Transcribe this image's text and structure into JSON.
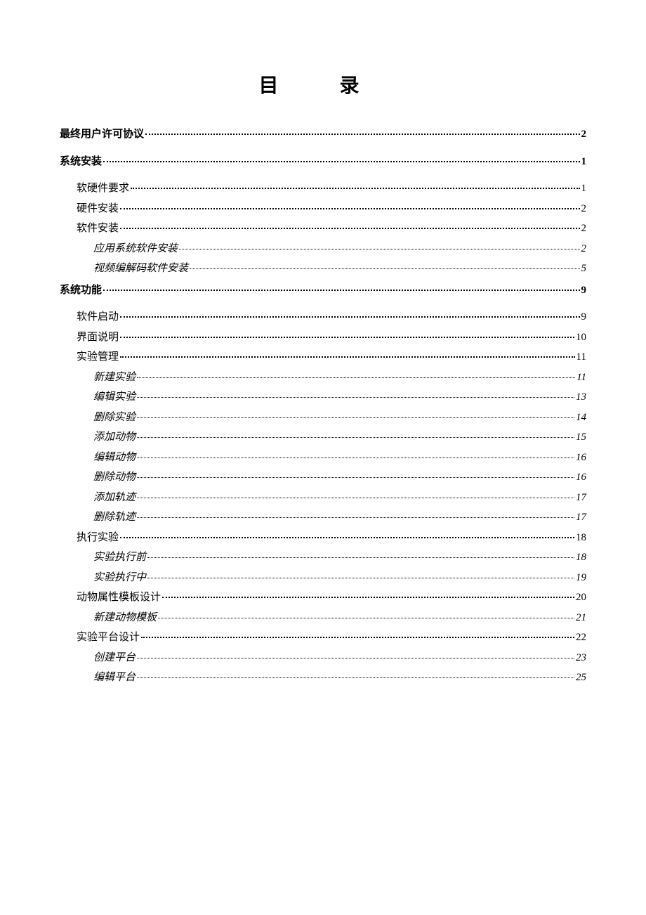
{
  "title": "目 录",
  "toc": [
    {
      "level": 1,
      "label": "最终用户许可协议",
      "page": "2"
    },
    {
      "level": 1,
      "label": "系统安装",
      "page": "1"
    },
    {
      "level": 2,
      "label": "软硬件要求",
      "page": "1"
    },
    {
      "level": 2,
      "label": "硬件安装",
      "page": "2"
    },
    {
      "level": 2,
      "label": "软件安装",
      "page": "2"
    },
    {
      "level": 3,
      "label": "应用系统软件安装",
      "page": "2"
    },
    {
      "level": 3,
      "label": "视频编解码软件安装",
      "page": "5"
    },
    {
      "level": 1,
      "label": "系统功能",
      "page": "9"
    },
    {
      "level": 2,
      "label": "软件启动",
      "page": "9"
    },
    {
      "level": 2,
      "label": "界面说明",
      "page": "10"
    },
    {
      "level": 2,
      "label": "实验管理",
      "page": "11"
    },
    {
      "level": 3,
      "label": "新建实验",
      "page": "11"
    },
    {
      "level": 3,
      "label": "编辑实验",
      "page": "13"
    },
    {
      "level": 3,
      "label": "删除实验",
      "page": "14"
    },
    {
      "level": 3,
      "label": "添加动物",
      "page": "15"
    },
    {
      "level": 3,
      "label": "编辑动物",
      "page": "16"
    },
    {
      "level": 3,
      "label": "删除动物",
      "page": "16"
    },
    {
      "level": 3,
      "label": "添加轨迹",
      "page": "17"
    },
    {
      "level": 3,
      "label": "删除轨迹",
      "page": "17"
    },
    {
      "level": 2,
      "label": "执行实验",
      "page": "18"
    },
    {
      "level": 3,
      "label": "实验执行前",
      "page": "18"
    },
    {
      "level": 3,
      "label": "实验执行中",
      "page": "19"
    },
    {
      "level": 2,
      "label": "动物属性模板设计",
      "page": "20"
    },
    {
      "level": 3,
      "label": "新建动物模板",
      "page": "21"
    },
    {
      "level": 2,
      "label": "实验平台设计",
      "page": "22"
    },
    {
      "level": 3,
      "label": "创建平台",
      "page": "23"
    },
    {
      "level": 3,
      "label": "编辑平台",
      "page": "25"
    }
  ]
}
